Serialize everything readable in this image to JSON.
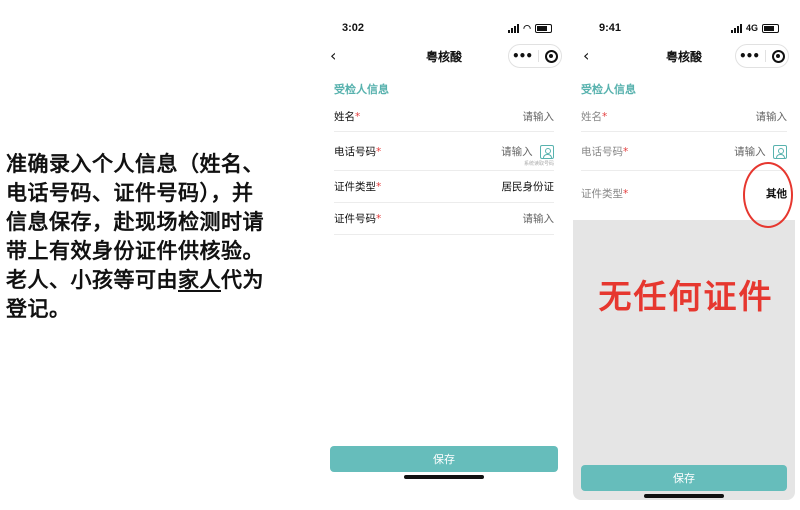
{
  "intro": {
    "line1": "准确录入个人信息（姓名、",
    "line2": "电话号码、证件号码），并",
    "line3": "信息保存，赴现场检测时请",
    "line4": "带上有效身份证件供核验。",
    "line5_a": "老人、小孩等可由",
    "line5_b": "家人",
    "line5_c": "代为",
    "line6": "登记。"
  },
  "phone1": {
    "time": "3:02",
    "title": "粤核酸",
    "menu_dots": "•••",
    "section_title": "受检人信息",
    "rows": [
      {
        "label": "姓名",
        "required": "*",
        "value": "请输入"
      },
      {
        "label": "电话号码",
        "required": "*",
        "value": "请输入",
        "hint": "系统读取号码"
      },
      {
        "label": "证件类型",
        "required": "*",
        "value": "居民身份证"
      },
      {
        "label": "证件号码",
        "required": "*",
        "value": "请输入"
      }
    ],
    "save_label": "保存",
    "back": "‹"
  },
  "phone2": {
    "time": "9:41",
    "network": "4G",
    "title": "粤核酸",
    "menu_dots": "•••",
    "section_title": "受检人信息",
    "rows": [
      {
        "label": "姓名",
        "required": "*",
        "value": "请输入"
      },
      {
        "label": "电话号码",
        "required": "*",
        "value": "请输入"
      },
      {
        "label": "证件类型",
        "required": "*",
        "value": "其他"
      }
    ],
    "annotation": "无任何证件",
    "save_label": "保存",
    "back": "‹"
  },
  "colors": {
    "accent": "#58b2ae",
    "button": "#66bdbb",
    "required": "#e43d3d",
    "annotation_red": "#e6372f"
  }
}
